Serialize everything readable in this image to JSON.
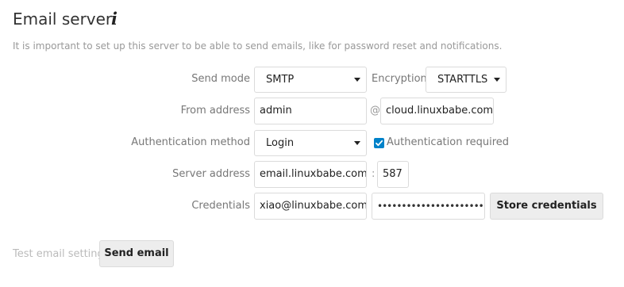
{
  "section": {
    "title": "Email server",
    "info_icon": "info-icon",
    "description": "It is important to set up this server to be able to send emails, like for password reset and notifications."
  },
  "form": {
    "send_mode": {
      "label": "Send mode",
      "value": "SMTP"
    },
    "encryption": {
      "label": "Encryption",
      "value": "STARTTLS"
    },
    "from_address": {
      "label": "From address",
      "user": "admin",
      "at": "@",
      "domain": "cloud.linuxbabe.com"
    },
    "auth_method": {
      "label": "Authentication method",
      "value": "Login"
    },
    "auth_required": {
      "label": "Authentication required",
      "checked": true
    },
    "server_address": {
      "label": "Server address",
      "host": "email.linuxbabe.com",
      "colon": ":",
      "port": "587"
    },
    "credentials": {
      "label": "Credentials",
      "username": "xiao@linuxbabe.com",
      "password": "••••••••••••••••••••••••",
      "store_button": "Store credentials"
    }
  },
  "test": {
    "label": "Test email settings",
    "button": "Send email"
  },
  "colors": {
    "accent": "#0082c9",
    "muted_text": "#999999",
    "border": "#dbdbdb"
  }
}
